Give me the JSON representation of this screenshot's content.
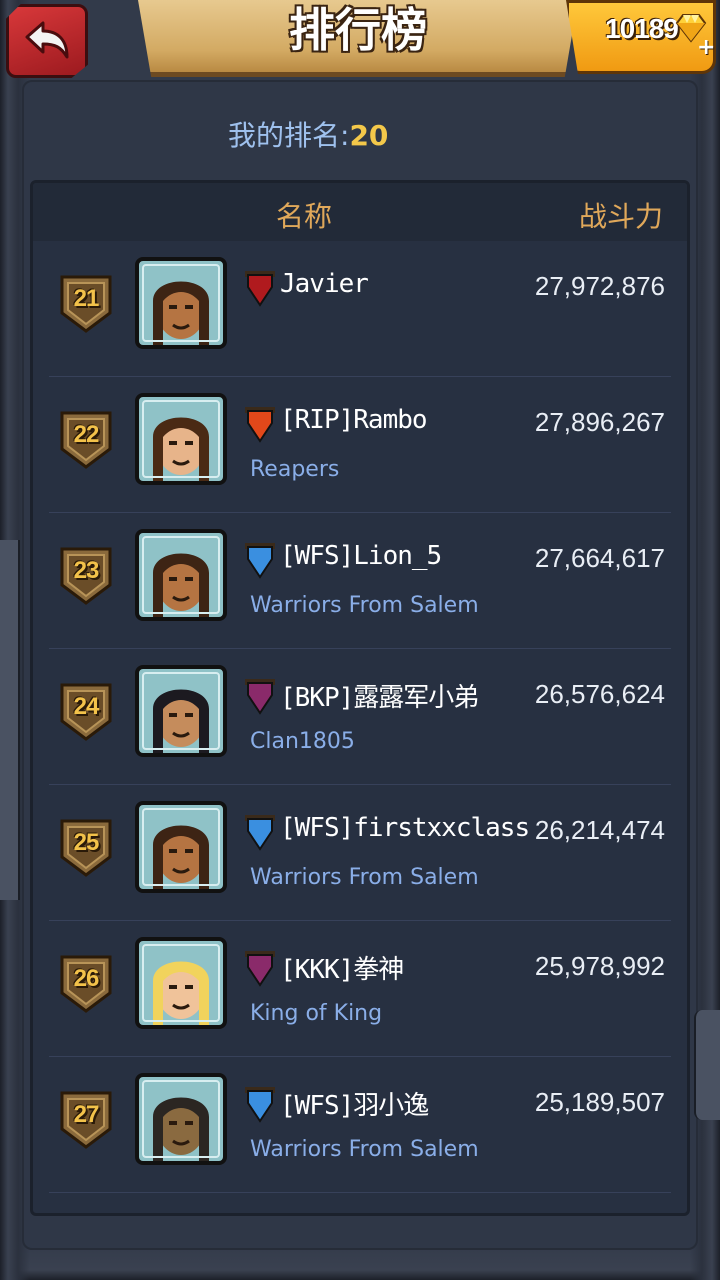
{
  "header": {
    "title": "排行榜",
    "gems": "10189"
  },
  "my_rank": {
    "label": "我的排名:",
    "value": "20"
  },
  "table": {
    "col_name": "名称",
    "col_power": "战斗力"
  },
  "rows": [
    {
      "rank": "21",
      "name": "Javier",
      "clan": "",
      "power": "27,972,876",
      "flag_color": "#b01a1e",
      "avatar": "bearded-warrior"
    },
    {
      "rank": "22",
      "name": "[RIP]Rambo",
      "clan": "Reapers",
      "power": "27,896,267",
      "flag_color": "#e2481a",
      "avatar": "female-warrior"
    },
    {
      "rank": "23",
      "name": "[WFS]Lion_5",
      "clan": "Warriors From Salem",
      "power": "27,664,617",
      "flag_color": "#3a8fe0",
      "avatar": "bearded-warrior"
    },
    {
      "rank": "24",
      "name": "[BKP]露露军小弟",
      "clan": "Clan1805",
      "power": "26,576,624",
      "flag_color": "#8a2a6a",
      "avatar": "long-hair-warrior"
    },
    {
      "rank": "25",
      "name": "[WFS]firstxxclass",
      "clan": "Warriors From Salem",
      "power": "26,214,474",
      "flag_color": "#3a8fe0",
      "avatar": "bearded-warrior"
    },
    {
      "rank": "26",
      "name": "[KKK]拳神",
      "clan": "King of King",
      "power": "25,978,992",
      "flag_color": "#8a2a6a",
      "avatar": "blonde-warrior"
    },
    {
      "rank": "27",
      "name": "[WFS]羽小逸",
      "clan": "Warriors From Salem",
      "power": "25,189,507",
      "flag_color": "#3a8fe0",
      "avatar": "beast-warrior"
    }
  ],
  "colors": {
    "accent_gold": "#f4c84a",
    "header_text": "#e0a85a",
    "clan_text": "#8aaee8"
  }
}
